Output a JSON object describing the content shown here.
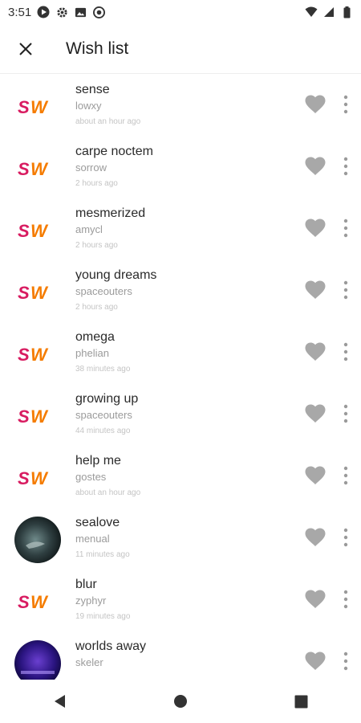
{
  "status_bar": {
    "time": "3:51",
    "left_icons": [
      "play-icon",
      "gear-icon",
      "image-icon",
      "cast-icon"
    ],
    "right_icons": [
      "wifi-icon",
      "signal-icon",
      "battery-icon"
    ]
  },
  "app_bar": {
    "close_icon": "close-icon",
    "title": "Wish list"
  },
  "brand_colors": {
    "s": "#d81b60",
    "w": "#f57c00",
    "heart": "#a8a8a8"
  },
  "items": [
    {
      "title": "sense",
      "artist": "lowxy",
      "time": "about an hour ago",
      "thumb": "sw-logo"
    },
    {
      "title": "carpe noctem",
      "artist": "sorrow",
      "time": "2 hours ago",
      "thumb": "sw-logo"
    },
    {
      "title": "mesmerized",
      "artist": "amycl",
      "time": "2 hours ago",
      "thumb": "sw-logo"
    },
    {
      "title": "young dreams",
      "artist": "spaceouters",
      "time": "2 hours ago",
      "thumb": "sw-logo"
    },
    {
      "title": "omega",
      "artist": "phelian",
      "time": "38 minutes ago",
      "thumb": "sw-logo"
    },
    {
      "title": "growing up",
      "artist": "spaceouters",
      "time": "44 minutes ago",
      "thumb": "sw-logo"
    },
    {
      "title": "help me",
      "artist": "gostes",
      "time": "about an hour ago",
      "thumb": "sw-logo"
    },
    {
      "title": "sealove",
      "artist": "menual",
      "time": "11 minutes ago",
      "thumb": "photo-sea"
    },
    {
      "title": "blur",
      "artist": "zyphyr",
      "time": "19 minutes ago",
      "thumb": "sw-logo"
    },
    {
      "title": "worlds away",
      "artist": "skeler",
      "time": "",
      "thumb": "photo-purple"
    }
  ],
  "nav_bar": {
    "icons": [
      "back-icon",
      "home-icon",
      "recents-icon"
    ]
  }
}
